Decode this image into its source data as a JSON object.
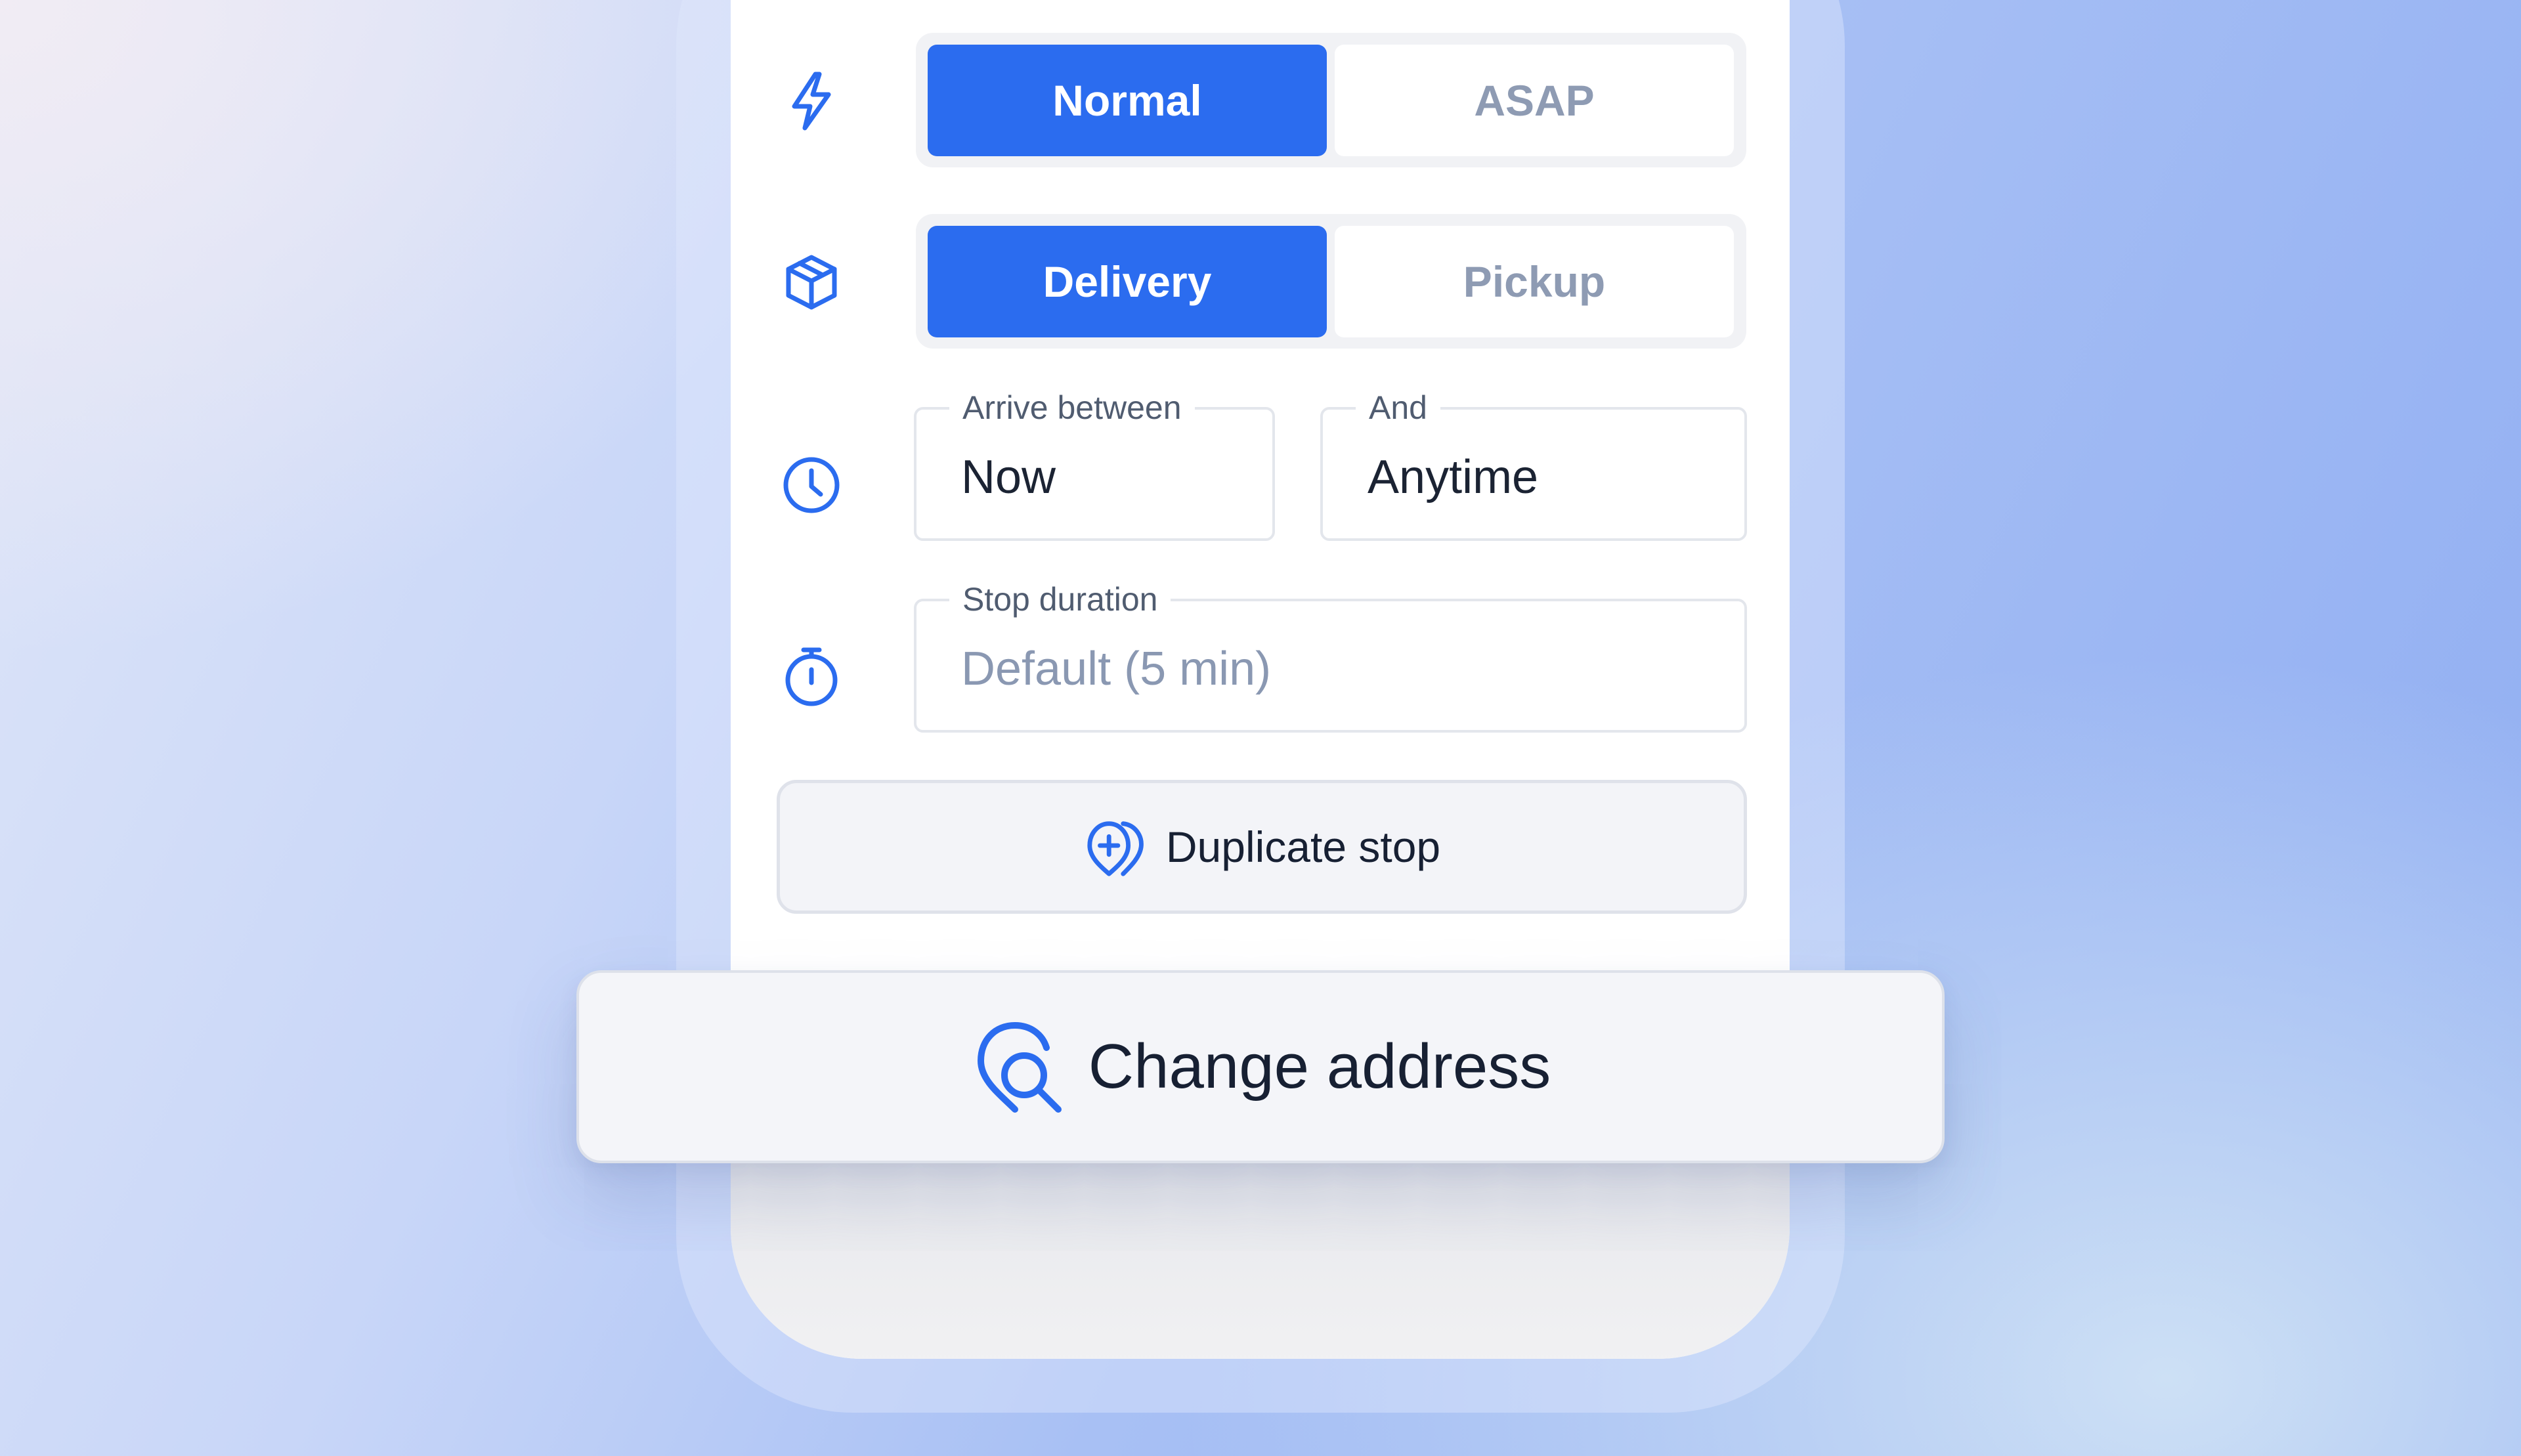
{
  "colors": {
    "accent": "#2b6cef",
    "text_primary": "#172033",
    "text_muted": "#8e9bb3",
    "field_border": "#e3e6ec"
  },
  "priority": {
    "icon": "lightning-icon",
    "options": [
      "Normal",
      "ASAP"
    ],
    "selected": "Normal"
  },
  "stop_type": {
    "icon": "package-box-icon",
    "options": [
      "Delivery",
      "Pickup"
    ],
    "selected": "Delivery"
  },
  "time_window": {
    "icon": "clock-icon",
    "arrive_between": {
      "label": "Arrive between",
      "value": "Now"
    },
    "and": {
      "label": "And",
      "value": "Anytime"
    }
  },
  "stop_duration": {
    "icon": "stopwatch-icon",
    "label": "Stop duration",
    "placeholder": "Default (5 min)"
  },
  "duplicate_stop": {
    "icon": "pin-plus-icon",
    "label": "Duplicate stop"
  },
  "change_address": {
    "icon": "pin-search-icon",
    "label": "Change address"
  }
}
